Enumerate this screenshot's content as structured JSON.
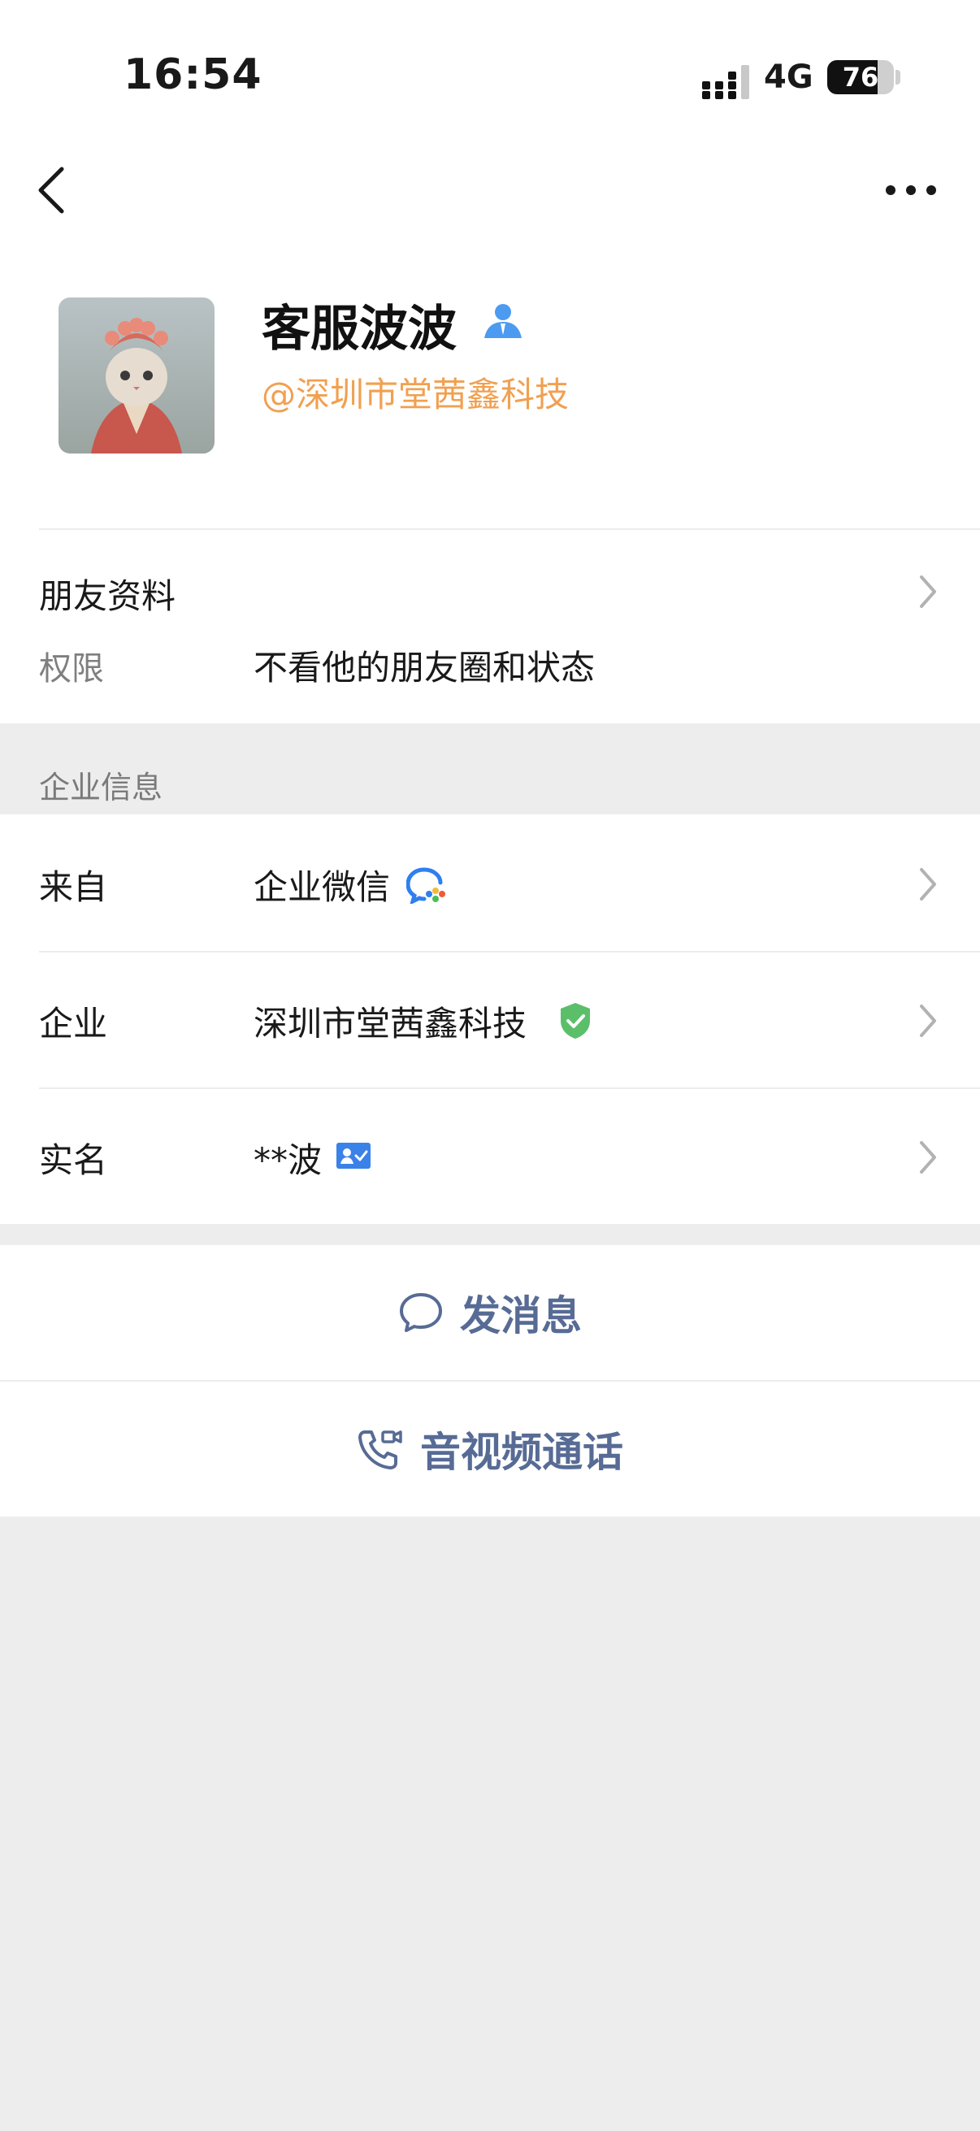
{
  "status_bar": {
    "time": "16:54",
    "network": "4G",
    "battery": "76",
    "battery_level": 0.76
  },
  "profile": {
    "name": "客服波波",
    "company_tag": "@深圳市堂茜鑫科技"
  },
  "friend_info": {
    "title": "朋友资料",
    "permission_label": "权限",
    "permission_value": "不看他的朋友圈和状态"
  },
  "enterprise": {
    "section_title": "企业信息",
    "rows": [
      {
        "label": "来自",
        "value": "企业微信"
      },
      {
        "label": "企业",
        "value": "深圳市堂茜鑫科技"
      },
      {
        "label": "实名",
        "value": "**波"
      }
    ]
  },
  "actions": {
    "send_message": "发消息",
    "av_call": "音视频通话"
  },
  "colors": {
    "accent": "#576b95",
    "company_tag": "#f1a050",
    "verified": "#5bbf6a",
    "background": "#ededed"
  },
  "icons": {
    "back": "chevron-left-icon",
    "more": "more-dots-icon",
    "contact_type": "person-icon",
    "wecom": "wecom-logo-icon",
    "verified": "shield-check-icon",
    "realname": "id-card-icon",
    "message": "chat-bubble-icon",
    "call": "phone-video-icon"
  }
}
